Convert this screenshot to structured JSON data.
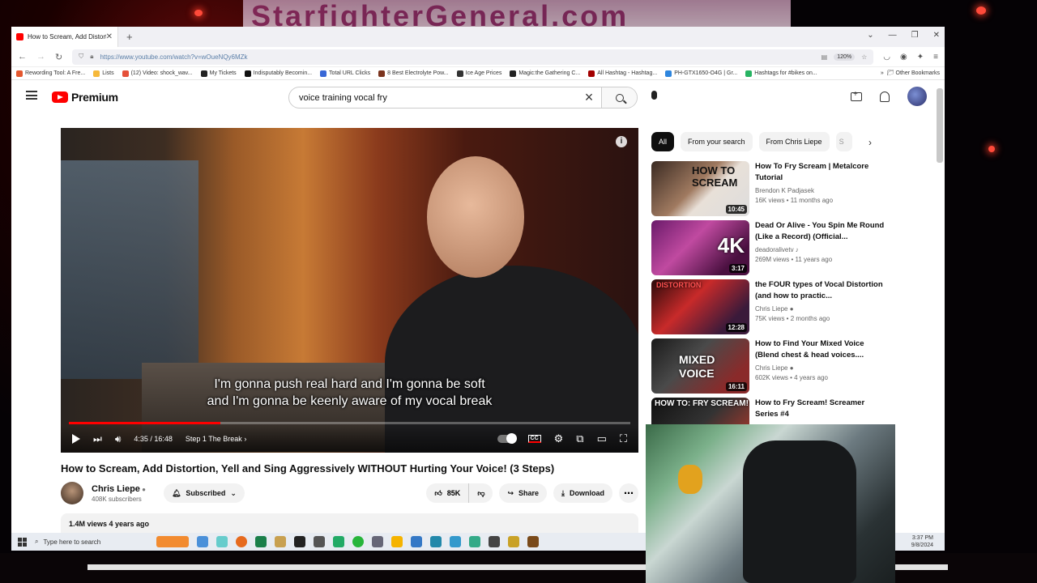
{
  "desktop": {
    "banner_text": "StarfighterGeneral.com"
  },
  "browser": {
    "tab": {
      "title": "How to Scream, Add Distortion, Yell"
    },
    "url": "https://www.youtube.com/watch?v=wOueNQy6MZk",
    "zoom": "120%",
    "bookmarks": [
      "Rewording Tool: A Fre...",
      "Lists",
      "(12) Video: shock_wav...",
      "My Tickets",
      "Indisputably Becomin...",
      "Total URL Clicks",
      "8 Best Electrolyte Pow...",
      "Ice Age Prices",
      "Magic:the Gathering C...",
      "All Hashtag - Hashtag...",
      "PH-GTX1650-O4G | Gr...",
      "Hashtags for #bikes on..."
    ],
    "other_bookmarks": "Other Bookmarks"
  },
  "youtube": {
    "logo_text": "Premium",
    "search_query": "voice training vocal fry",
    "player": {
      "caption_line1": "I'm gonna push real hard and I'm gonna be soft",
      "caption_line2": "and I'm gonna be keenly aware of my vocal break",
      "time": "4:35 / 16:48",
      "chapter": "Step 1 The Break",
      "progress": 0.27,
      "info_label": "i"
    },
    "video": {
      "title": "How to Scream, Add Distortion, Yell and Sing Aggressively WITHOUT Hurting Your Voice! (3 Steps)",
      "channel": "Chris Liepe",
      "subscribers": "408K subscribers",
      "subscribed_label": "Subscribed",
      "likes": "85K",
      "share_label": "Share",
      "download_label": "Download",
      "views_date": "1.4M views  4 years ago"
    },
    "chips": [
      "All",
      "From your search",
      "From Chris Liepe",
      "S"
    ],
    "recommendations": [
      {
        "title": "How To Fry Scream | Metalcore Tutorial",
        "channel": "Brendon K Padjasek",
        "stats": "16K views • 11 months ago",
        "duration": "10:45",
        "thumb_text": "HOW TO SCREAM"
      },
      {
        "title": "Dead Or Alive - You Spin Me Round (Like a Record) (Official...",
        "channel": "deadoralivetv ♪",
        "stats": "269M views • 11 years ago",
        "duration": "3:17",
        "thumb_text": "4K"
      },
      {
        "title": "the FOUR types of Vocal Distortion (and how to practic...",
        "channel": "Chris Liepe ●",
        "stats": "75K views • 2 months ago",
        "duration": "12:28",
        "thumb_text": "DISTORTION"
      },
      {
        "title": "How to Find Your Mixed Voice (Blend chest & head voices....",
        "channel": "Chris Liepe ●",
        "stats": "602K views • 4 years ago",
        "duration": "16:11",
        "thumb_text": "MIXED VOICE"
      },
      {
        "title": "How to Fry Scream! Screamer Series #4",
        "channel": "",
        "stats": "",
        "duration": "",
        "thumb_text": "HOW TO: FRY SCREAM!"
      }
    ]
  },
  "taskbar": {
    "search_placeholder": "Type here to search",
    "clock_time": "3:37 PM",
    "clock_date": "9/8/2024"
  }
}
